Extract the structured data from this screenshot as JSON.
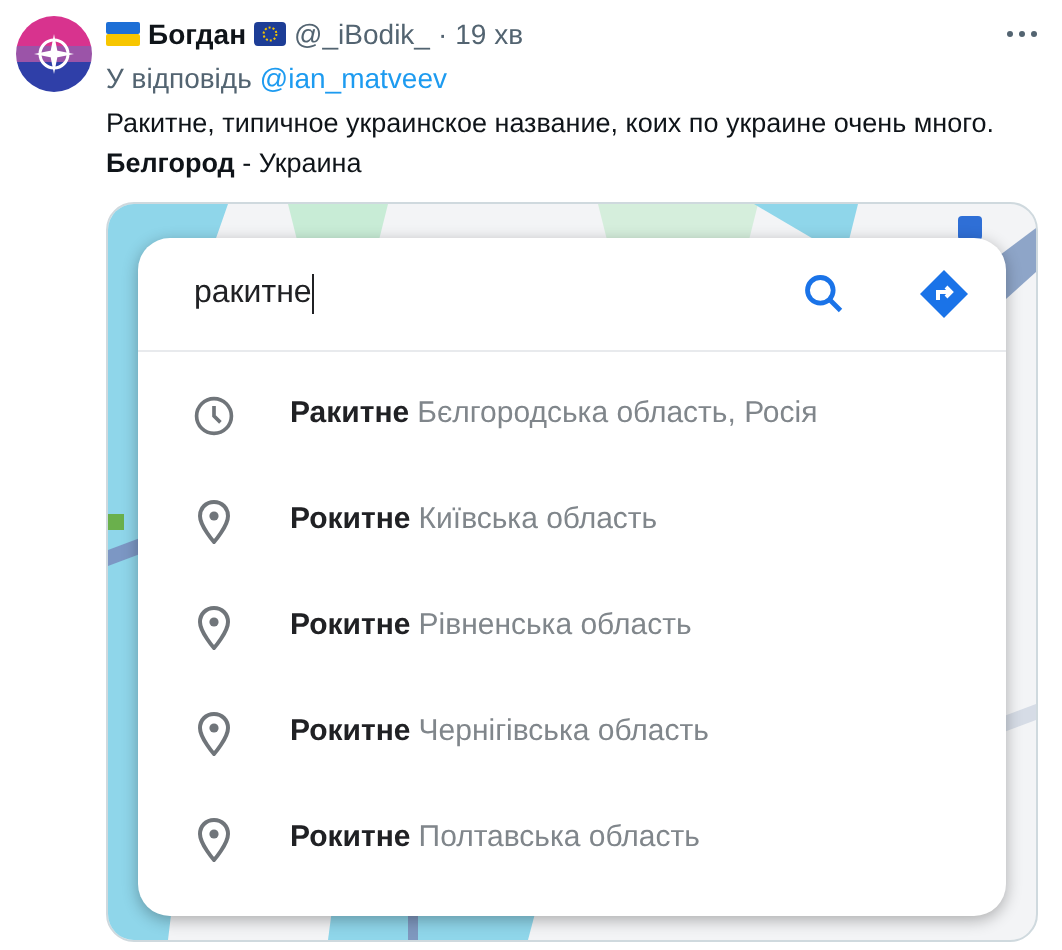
{
  "tweet": {
    "display_name": "Богдан",
    "handle": "@_iBodik_",
    "separator": "·",
    "time": "19 хв",
    "reply_prefix": "У відповідь",
    "reply_to": "@ian_matveev",
    "text_line_1": "Ракитне, типичное украинское название, коих по украине очень много.",
    "text_line_2": "**Белгород** - Украина"
  },
  "embedded_screenshot": {
    "kind": "picture",
    "search": {
      "value": "ракитне"
    },
    "suggestions": [
      {
        "kind": "history",
        "name": "Ракитне",
        "region": "Бєлгородська область, Росія"
      },
      {
        "kind": "place",
        "name": "Рокитне",
        "region": "Київська область"
      },
      {
        "kind": "place",
        "name": "Рокитне",
        "region": "Рівненська область"
      },
      {
        "kind": "place",
        "name": "Рокитне",
        "region": "Чернігівська область"
      },
      {
        "kind": "place",
        "name": "Рокитне",
        "region": "Полтавська область"
      }
    ]
  }
}
